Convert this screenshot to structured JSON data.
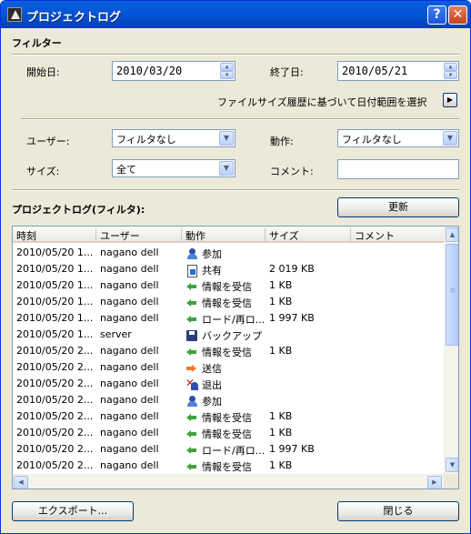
{
  "window": {
    "title": "プロジェクトログ",
    "help_glyph": "?",
    "close_glyph": "✕"
  },
  "filter": {
    "section_title": "フィルター",
    "start_label": "開始日:",
    "start_value": "2010/03/20",
    "end_label": "終了日:",
    "end_value": "2010/05/21",
    "range_link_label": "ファイルサイズ履歴に基づいて日付範囲を選択",
    "range_button_glyph": "▶",
    "user_label": "ユーザー:",
    "user_value": "フィルタなし",
    "action_label": "動作:",
    "action_value": "フィルタなし",
    "size_label": "サイズ:",
    "size_value": "全て",
    "comment_label": "コメント:",
    "comment_value": ""
  },
  "log": {
    "section_title": "プロジェクトログ(フィルタ):",
    "refresh_label": "更新",
    "columns": [
      "時刻",
      "ユーザー",
      "動作",
      "サイズ",
      "コメント"
    ],
    "rows": [
      {
        "time": "2010/05/20 1...",
        "user": "nagano dell",
        "icon": "user-join",
        "action": "参加",
        "size": ""
      },
      {
        "time": "2010/05/20 1...",
        "user": "nagano dell",
        "icon": "doc-share",
        "action": "共有",
        "size": "2 019 KB"
      },
      {
        "time": "2010/05/20 1...",
        "user": "nagano dell",
        "icon": "arrow-left",
        "action": "情報を受信",
        "size": "1 KB"
      },
      {
        "time": "2010/05/20 1...",
        "user": "nagano dell",
        "icon": "arrow-left",
        "action": "情報を受信",
        "size": "1 KB"
      },
      {
        "time": "2010/05/20 1...",
        "user": "nagano dell",
        "icon": "arrow-left",
        "action": "ロード/再ロ...",
        "size": "1 997 KB"
      },
      {
        "time": "2010/05/20 1...",
        "user": "server",
        "icon": "floppy-backup",
        "action": "バックアップ",
        "size": ""
      },
      {
        "time": "2010/05/20 2...",
        "user": "nagano dell",
        "icon": "arrow-left",
        "action": "情報を受信",
        "size": "1 KB"
      },
      {
        "time": "2010/05/20 2...",
        "user": "nagano dell",
        "icon": "arrow-right",
        "action": "送信",
        "size": ""
      },
      {
        "time": "2010/05/20 2...",
        "user": "nagano dell",
        "icon": "user-leave",
        "action": "退出",
        "size": ""
      },
      {
        "time": "2010/05/20 2...",
        "user": "nagano dell",
        "icon": "user-join",
        "action": "参加",
        "size": ""
      },
      {
        "time": "2010/05/20 2...",
        "user": "nagano dell",
        "icon": "arrow-left",
        "action": "情報を受信",
        "size": "1 KB"
      },
      {
        "time": "2010/05/20 2...",
        "user": "nagano dell",
        "icon": "arrow-left",
        "action": "情報を受信",
        "size": "1 KB"
      },
      {
        "time": "2010/05/20 2...",
        "user": "nagano dell",
        "icon": "arrow-left",
        "action": "ロード/再ロ...",
        "size": "1 997 KB"
      },
      {
        "time": "2010/05/20 2...",
        "user": "nagano dell",
        "icon": "arrow-left",
        "action": "情報を受信",
        "size": "1 KB"
      }
    ]
  },
  "footer": {
    "export_label": "エクスポート...",
    "close_label": "閉じる"
  },
  "colors": {
    "titlebar": "#0455d8",
    "dialog_bg": "#ece9d8",
    "border": "#7f9db9"
  }
}
